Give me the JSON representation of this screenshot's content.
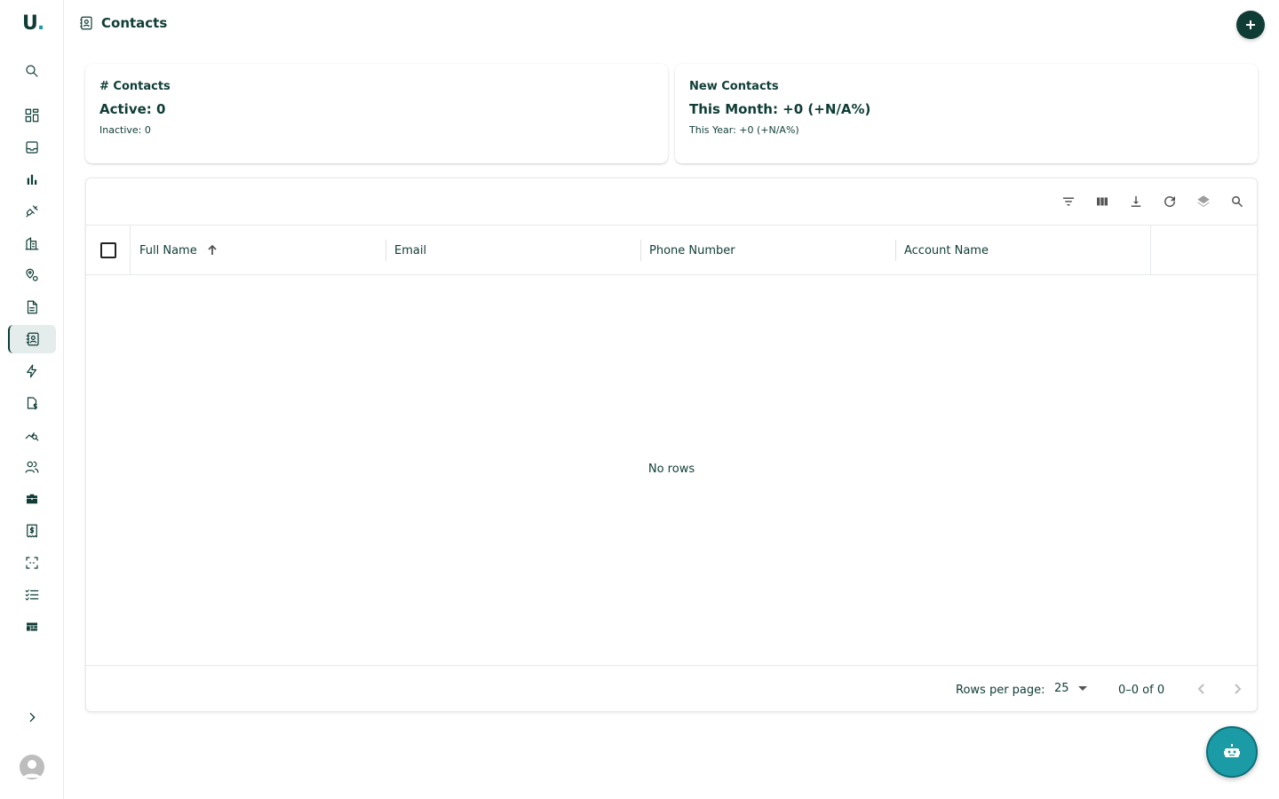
{
  "app": {
    "logo_text": "U",
    "logo_dot": "."
  },
  "header": {
    "title": "Contacts",
    "add_label": "+"
  },
  "sidebar": {
    "items": [
      {
        "icon": "search-icon"
      },
      {
        "icon": "dashboard-icon"
      },
      {
        "icon": "inbox-icon"
      },
      {
        "icon": "bar-chart-icon"
      },
      {
        "icon": "plug-icon"
      },
      {
        "icon": "building-icon"
      },
      {
        "icon": "location-icon"
      },
      {
        "icon": "document-icon"
      },
      {
        "icon": "contacts-icon",
        "active": true
      },
      {
        "icon": "lightning-icon"
      },
      {
        "icon": "invoice-icon"
      },
      {
        "icon": "analytics-icon"
      },
      {
        "icon": "people-icon"
      },
      {
        "icon": "briefcase-icon"
      },
      {
        "icon": "receipt-icon"
      },
      {
        "icon": "scan-icon"
      },
      {
        "icon": "checklist-icon"
      },
      {
        "icon": "board-icon"
      }
    ]
  },
  "stats": {
    "contacts": {
      "title": "# Contacts",
      "primary": "Active: 0",
      "secondary": "Inactive: 0"
    },
    "new_contacts": {
      "title": "New Contacts",
      "primary": "This Month: +0 (+N/A%)",
      "secondary": "This Year: +0 (+N/A%)"
    }
  },
  "grid": {
    "toolbar": [
      "filter-icon",
      "columns-icon",
      "download-icon",
      "refresh-icon",
      "layers-icon",
      "search-icon"
    ],
    "columns": [
      "Full Name",
      "Email",
      "Phone Number",
      "Account Name"
    ],
    "sort_column": "Full Name",
    "sort_direction": "asc",
    "empty_text": "No rows",
    "footer": {
      "rows_per_page_label": "Rows per page:",
      "rows_per_page_value": "25",
      "range_text": "0–0 of 0"
    }
  },
  "colors": {
    "primary": "#0f3d36",
    "accent": "#1a9ba6",
    "border": "#e6e9ea"
  }
}
